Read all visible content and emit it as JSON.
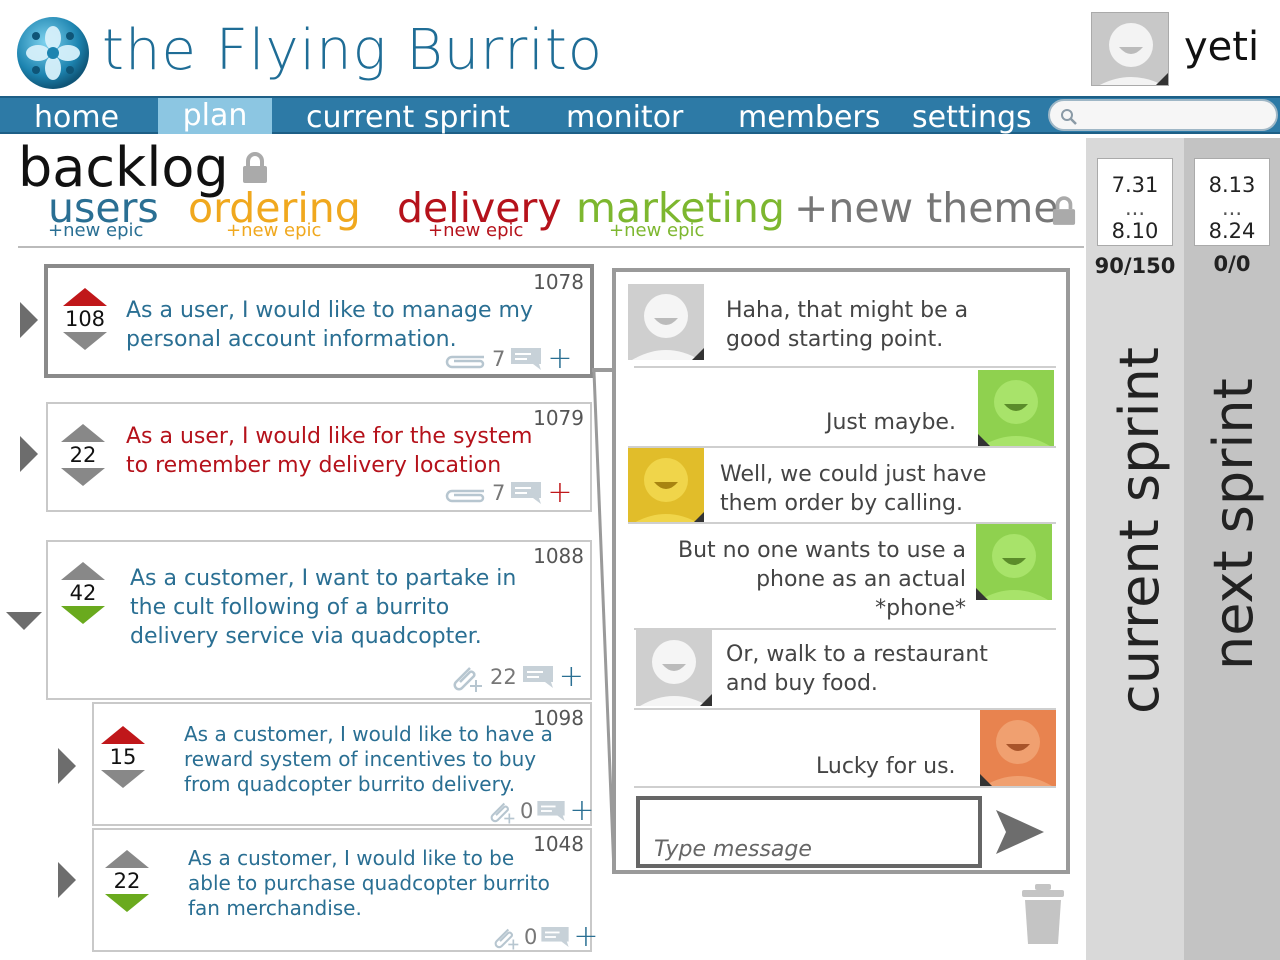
{
  "header": {
    "app_title": "the Flying Burrito",
    "user": {
      "name": "yeti"
    }
  },
  "nav": {
    "items": [
      {
        "label": "home",
        "active": false
      },
      {
        "label": "plan",
        "active": true
      },
      {
        "label": "current sprint",
        "active": false
      },
      {
        "label": "monitor",
        "active": false
      },
      {
        "label": "members",
        "active": false
      },
      {
        "label": "settings",
        "active": false
      }
    ],
    "search": {
      "placeholder": "",
      "icon": "search-icon"
    }
  },
  "backlog": {
    "title": "backlog",
    "themes": [
      {
        "label": "users",
        "color": "#2a6f93",
        "new_epic": "+new epic"
      },
      {
        "label": "ordering",
        "color": "#f0a81e",
        "new_epic": "+new epic"
      },
      {
        "label": "delivery",
        "color": "#b5121b",
        "new_epic": "+new epic"
      },
      {
        "label": "marketing",
        "color": "#7db72f",
        "new_epic": "+new epic"
      }
    ],
    "new_theme": "+new theme",
    "stories": [
      {
        "id": "1078",
        "votes": "108",
        "text": [
          "As a user, I would like to manage my",
          "personal account information."
        ],
        "comments": "7",
        "color": "#2a6f93",
        "selected": true
      },
      {
        "id": "1079",
        "votes": "22",
        "text": [
          "As a user, I would like for the system",
          "to remember my delivery location"
        ],
        "comments": "7",
        "color": "#b5121b",
        "selected": false
      },
      {
        "id": "1088",
        "votes": "42",
        "text": [
          "As a customer, I want to partake in",
          "the cult following of  a burrito",
          "delivery service via quadcopter."
        ],
        "comments": "22",
        "color": "#2a6f93",
        "selected": false
      },
      {
        "id": "1098",
        "votes": "15",
        "text": [
          "As a customer, I would like to have a",
          "reward system of  incentives to buy",
          "from quadcopter burrito delivery."
        ],
        "comments": "0",
        "color": "#2a6f93",
        "selected": false
      },
      {
        "id": "1048",
        "votes": "22",
        "text": [
          "As a customer, I would like to be",
          "able to purchase quadcopter burrito",
          "fan merchandise."
        ],
        "comments": "0",
        "color": "#2a6f93",
        "selected": false
      }
    ]
  },
  "chat": {
    "messages": [
      {
        "side": "left",
        "lines": [
          "Haha, that might be a",
          "good starting point."
        ],
        "avatar_color": "#cfcfcf"
      },
      {
        "side": "right",
        "lines": [
          "Just maybe."
        ],
        "avatar_color": "#8fd14f"
      },
      {
        "side": "left",
        "lines": [
          "Well, we could just have",
          "them order by calling."
        ],
        "avatar_color": "#e1bd2a"
      },
      {
        "side": "right",
        "lines": [
          "But no one wants to use a",
          "phone as an actual",
          "*phone*"
        ],
        "avatar_color": "#8fd14f"
      },
      {
        "side": "left",
        "lines": [
          "Or, walk to a restaurant",
          "and buy food."
        ],
        "avatar_color": "#cfcfcf"
      },
      {
        "side": "right",
        "lines": [
          "Lucky for us."
        ],
        "avatar_color": "#e8834f"
      }
    ],
    "input_placeholder": "Type message"
  },
  "sprints": [
    {
      "label": "current sprint",
      "date_start": "7.31",
      "separator": "...",
      "date_end": "8.10",
      "points": "90/150"
    },
    {
      "label": "next sprint",
      "date_start": "8.13",
      "separator": "...",
      "date_end": "8.24",
      "points": "0/0"
    }
  ]
}
